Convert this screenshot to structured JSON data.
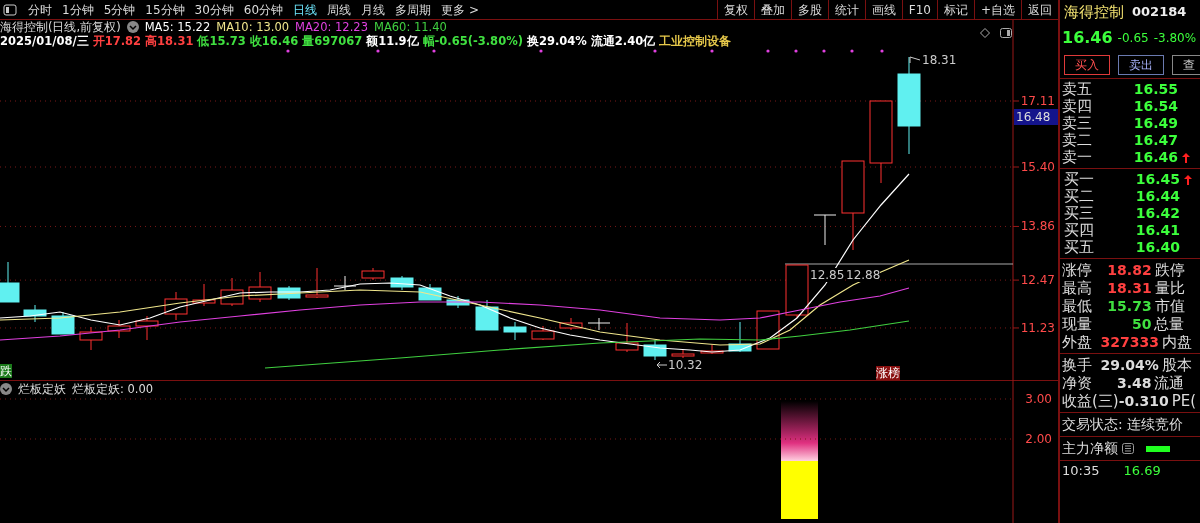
{
  "toolbar": {
    "periods": [
      {
        "label": "分时",
        "selected": false
      },
      {
        "label": "1分钟",
        "selected": false
      },
      {
        "label": "5分钟",
        "selected": false
      },
      {
        "label": "15分钟",
        "selected": false
      },
      {
        "label": "30分钟",
        "selected": false
      },
      {
        "label": "60分钟",
        "selected": false
      },
      {
        "label": "日线",
        "selected": true
      },
      {
        "label": "周线",
        "selected": false
      },
      {
        "label": "月线",
        "selected": false
      },
      {
        "label": "多周期",
        "selected": false
      },
      {
        "label": "更多 >",
        "selected": false
      }
    ],
    "buttons": [
      "复权",
      "叠加",
      "多股",
      "统计",
      "画线",
      "F10",
      "标记",
      "+自选",
      "返回"
    ]
  },
  "chart": {
    "title": "海得控制(日线,前复权)",
    "ma": [
      {
        "label": "MA5: 15.22",
        "color": "#ffffff"
      },
      {
        "label": "MA10: 13.00",
        "color": "#f0e68c"
      },
      {
        "label": "MA20: 12.23",
        "color": "#e040e0"
      },
      {
        "label": "MA60: 11.40",
        "color": "#40d040"
      }
    ],
    "quote": [
      {
        "text": "2025/01/08/三",
        "color": "#ffffff"
      },
      {
        "text": "开17.82",
        "color": "#ff4040"
      },
      {
        "text": "高18.31",
        "color": "#ff4040"
      },
      {
        "text": "低15.73",
        "color": "#40e040"
      },
      {
        "text": "收16.46",
        "color": "#40e040"
      },
      {
        "text": "量697067",
        "color": "#40e040"
      },
      {
        "text": "额11.9亿",
        "color": "#ffffff"
      },
      {
        "text": "幅-0.65(-3.80%)",
        "color": "#40e040"
      },
      {
        "text": "换29.04%",
        "color": "#ffffff"
      },
      {
        "text": "流通2.40亿",
        "color": "#ffffff"
      },
      {
        "text": "工业控制设备",
        "color": "#e6c84a"
      }
    ],
    "price_ticks": [
      "17.11",
      "15.40",
      "13.86",
      "12.47",
      "11.23"
    ],
    "price_tag": "16.48",
    "high_label": "18.31",
    "low_label": "10.32",
    "range_labels": [
      "12.85",
      "12.88"
    ],
    "badges": [
      {
        "text": "跌",
        "kind": "fall"
      },
      {
        "text": "涨榜",
        "kind": "rise"
      }
    ]
  },
  "indicator": {
    "name": "烂板定妖",
    "reading": "烂板定妖: 0.00",
    "ticks": [
      "3.00",
      "2.00"
    ]
  },
  "quote_panel": {
    "name": "海得控制",
    "code": "002184",
    "price": "16.46",
    "change": "-0.65",
    "change_pct": "-3.80%",
    "actions": [
      {
        "label": "买入",
        "kind": "buy"
      },
      {
        "label": "卖出",
        "kind": "sell"
      },
      {
        "label": "查",
        "kind": "other"
      }
    ],
    "asks": [
      {
        "label": "卖五",
        "price": "16.55",
        "arrow": false
      },
      {
        "label": "卖四",
        "price": "16.54",
        "arrow": false
      },
      {
        "label": "卖三",
        "price": "16.49",
        "arrow": false
      },
      {
        "label": "卖二",
        "price": "16.47",
        "arrow": false
      },
      {
        "label": "卖一",
        "price": "16.46",
        "arrow": true
      }
    ],
    "bids": [
      {
        "label": "买一",
        "price": "16.45",
        "arrow": true
      },
      {
        "label": "买二",
        "price": "16.44",
        "arrow": false
      },
      {
        "label": "买三",
        "price": "16.42",
        "arrow": false
      },
      {
        "label": "买四",
        "price": "16.41",
        "arrow": false
      },
      {
        "label": "买五",
        "price": "16.40",
        "arrow": false
      }
    ],
    "stats": [
      {
        "label": "涨停",
        "value": "18.82",
        "color": "#ff4040",
        "side": "跌停"
      },
      {
        "label": "最高",
        "value": "18.31",
        "color": "#ff4040",
        "side": "量比"
      },
      {
        "label": "最低",
        "value": "15.73",
        "color": "#40e040",
        "side": "市值"
      },
      {
        "label": "现量",
        "value": "50",
        "color": "#40e040",
        "side": "总量"
      },
      {
        "label": "外盘",
        "value": "327333",
        "color": "#ff4040",
        "side": "内盘"
      }
    ],
    "finance": [
      {
        "label": "换手",
        "value": "29.04%",
        "side": "股本"
      },
      {
        "label": "净资",
        "value": "3.48",
        "side": "流通"
      },
      {
        "label": "收益(三)",
        "value": "-0.310",
        "side": "PE("
      }
    ],
    "trade_status": "交易状态: 连续竞价",
    "net_flow_label": "主力净额",
    "tick": {
      "time": "10:35",
      "price": "16.69"
    }
  }
}
